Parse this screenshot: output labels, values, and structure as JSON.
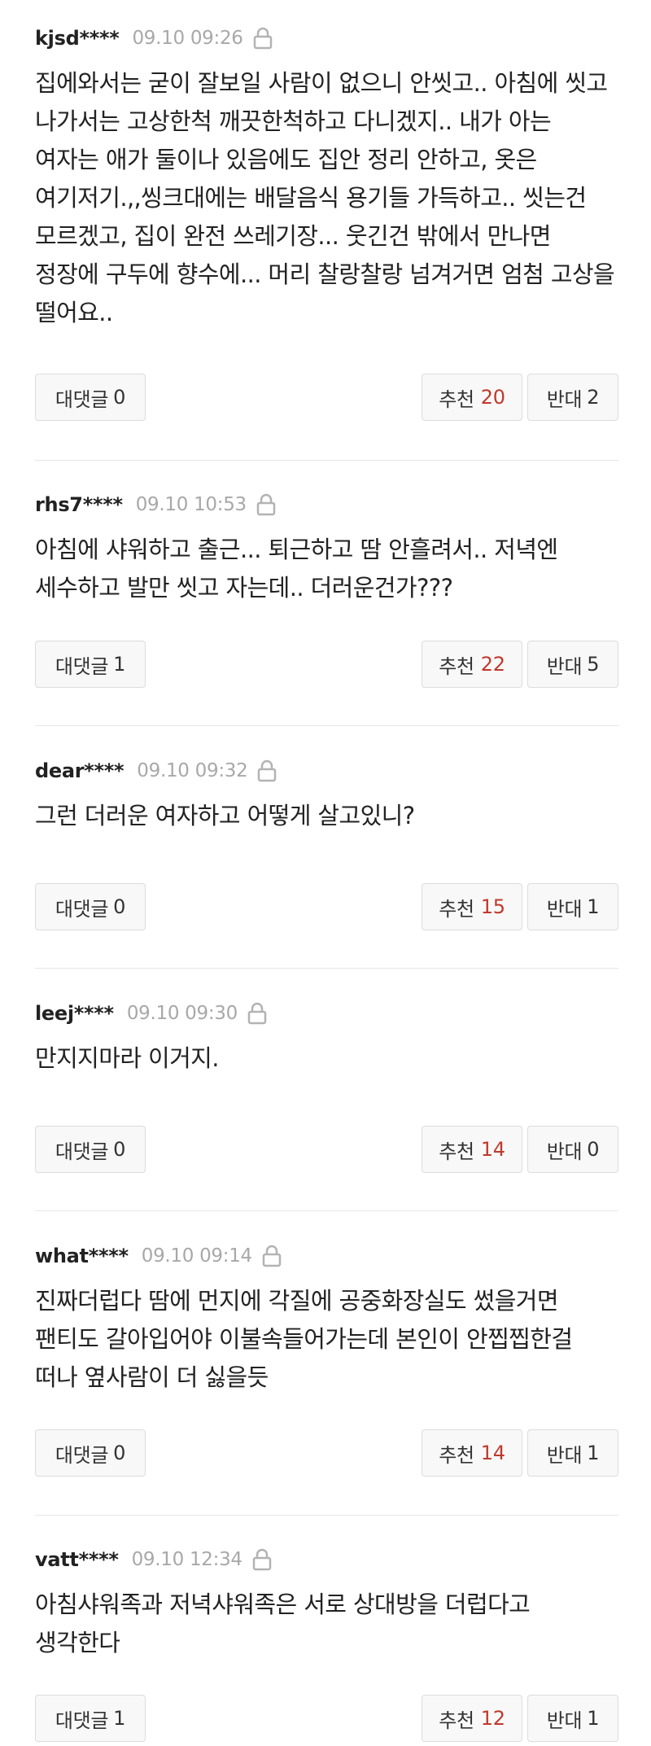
{
  "labels": {
    "reply": "대댓글",
    "like": "추천",
    "dislike": "반대"
  },
  "comments": [
    {
      "author": "kjsd****",
      "time": "09.10 09:26",
      "text": "집에와서는 굳이 잘보일 사람이 없으니 안씻고.. 아침에 씻고 나가서는 고상한척 깨끗한척하고 다니겠지.. 내가 아는 여자는 애가 둘이나 있음에도 집안 정리 안하고, 옷은 여기저기.,,씽크대에는 배달음식 용기들 가득하고.. 씻는건 모르겠고, 집이 완전 쓰레기장... 웃긴건 밖에서 만나면 정장에 구두에 향수에... 머리 찰랑찰랑 넘겨거면 엄첨 고상을 떨어요..",
      "replies": "0",
      "likes": "20",
      "dislikes": "2"
    },
    {
      "author": "rhs7****",
      "time": "09.10 10:53",
      "text": "아침에 샤워하고 출근... 퇴근하고 땀 안흘려서.. 저녁엔 세수하고 발만 씻고 자는데.. 더러운건가???",
      "replies": "1",
      "likes": "22",
      "dislikes": "5"
    },
    {
      "author": "dear****",
      "time": "09.10 09:32",
      "text": "그런 더러운 여자하고 어떻게 살고있니?",
      "replies": "0",
      "likes": "15",
      "dislikes": "1"
    },
    {
      "author": "leej****",
      "time": "09.10 09:30",
      "text": "만지지마라 이거지.",
      "replies": "0",
      "likes": "14",
      "dislikes": "0"
    },
    {
      "author": "what****",
      "time": "09.10 09:14",
      "text": "진짜더럽다 땀에 먼지에 각질에 공중화장실도 썼을거면 팬티도 갈아입어야 이불속들어가는데 본인이 안찝찝한걸 떠나 옆사람이 더 싫을듯",
      "replies": "0",
      "likes": "14",
      "dislikes": "1"
    },
    {
      "author": "vatt****",
      "time": "09.10 12:34",
      "text": "아침샤워족과 저녁샤워족은 서로 상대방을 더럽다고 생각한다",
      "replies": "1",
      "likes": "12",
      "dislikes": "1"
    }
  ]
}
